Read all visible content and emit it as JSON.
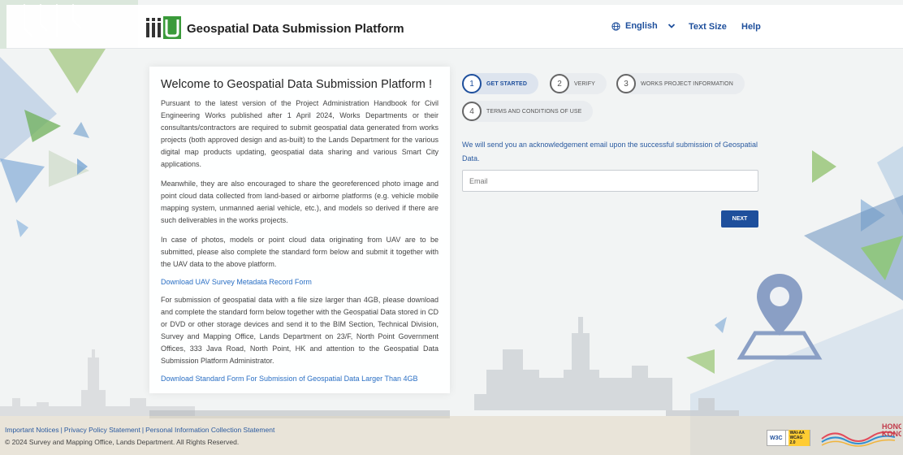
{
  "header": {
    "title": "Geospatial Data Submission Platform",
    "language": "English",
    "text_size": "Text Size",
    "help": "Help"
  },
  "welcome": {
    "heading": "Welcome to Geospatial Data Submission Platform !",
    "p1": "Pursuant to the latest version of the Project Administration Handbook for Civil Engineering Works published after 1 April 2024, Works Departments or their consultants/contractors are required to submit geospatial data generated from works projects (both approved design and as-built) to the Lands Department for the various digital map products updating, geospatial data sharing and various Smart City applications.",
    "p2": "Meanwhile, they are also encouraged to share the georeferenced photo image and point cloud data collected from land-based or airborne platforms (e.g. vehicle mobile mapping system, unmanned aerial vehicle, etc.), and models so derived if there are such deliverables in the works projects.",
    "p3": "In case of photos, models or point cloud data originating from UAV are to be submitted, please also complete the standard form below and submit it together with the UAV data to the above platform.",
    "link_uav": "Download UAV Survey Metadata Record Form",
    "p4": "For submission of geospatial data with a file size larger than 4GB, please download and complete the standard form below together with the Geospatial Data stored in CD or DVD or other storage devices and send it to the BIM Section, Technical Division, Survey and Mapping Office, Lands Department on 23/F, North Point Government Offices, 333 Java Road, North Point, HK and attention to the Geospatial Data Submission Platform Administrator.",
    "link_form": "Download Standard Form For Submission of Geospatial Data Larger Than 4GB"
  },
  "steps": [
    {
      "num": "1",
      "label": "GET STARTED"
    },
    {
      "num": "2",
      "label": "VERIFY"
    },
    {
      "num": "3",
      "label": "WORKS PROJECT INFORMATION"
    },
    {
      "num": "4",
      "label": "TERMS AND CONDITIONS OF USE"
    }
  ],
  "form": {
    "ack_text": "We will send you an acknowledgement email upon the successful submission of Geospatial Data.",
    "email_placeholder": "Email",
    "next_label": "NEXT"
  },
  "footer": {
    "link1": "Important Notices",
    "link2": "Privacy Policy Statement",
    "link3": "Personal Information Collection Statement",
    "copyright": "© 2024 Survey and Mapping Office, Lands Department. All Rights Reserved.",
    "w3c": "W3C",
    "wcag_line1": "WAI-AA",
    "wcag_line2": "WCAG 2.0",
    "hk_line1": "HONG",
    "hk_line2": "KONG"
  },
  "colors": {
    "brand": "#1e4f9c",
    "link": "#2a6fc4",
    "logo_green": "#3a9a3a"
  }
}
